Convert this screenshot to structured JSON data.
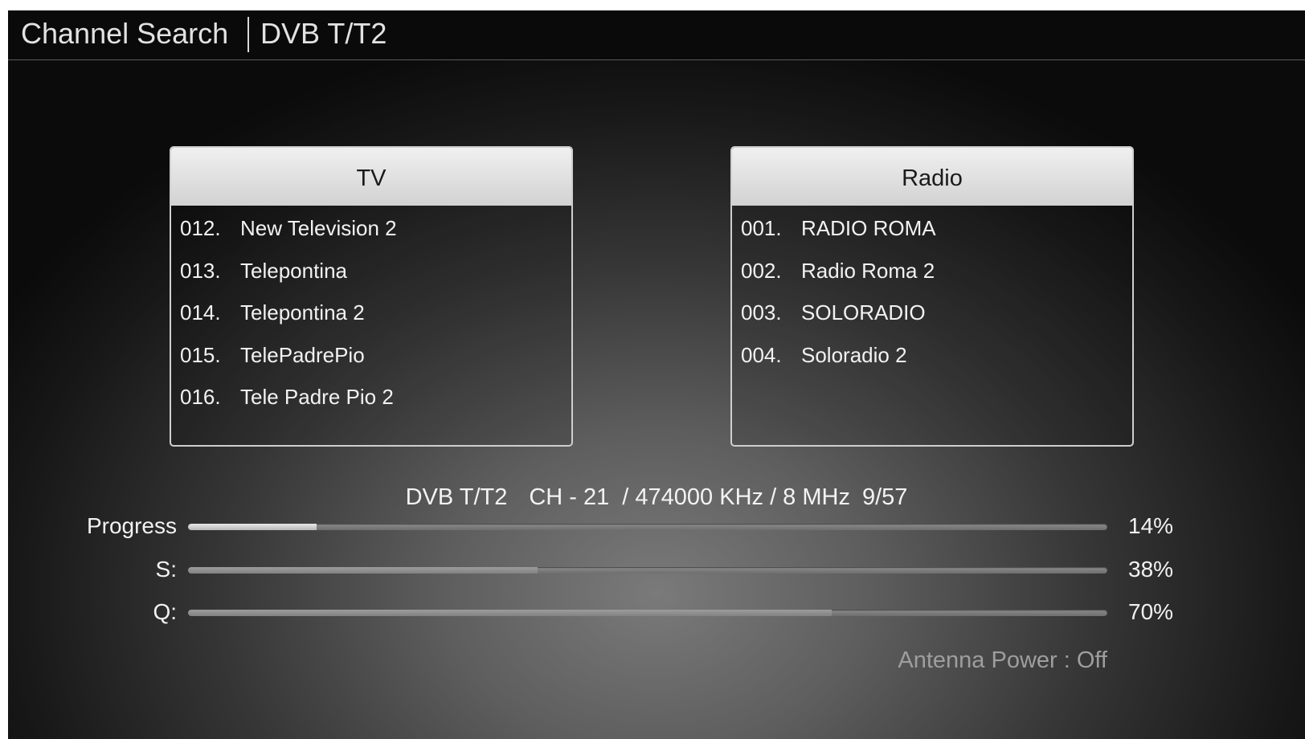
{
  "header": {
    "title": "Channel Search",
    "subtitle": "DVB T/T2"
  },
  "tv": {
    "heading": "TV",
    "channels": [
      {
        "num": "012.",
        "name": "New Television 2"
      },
      {
        "num": "013.",
        "name": "Telepontina"
      },
      {
        "num": "014.",
        "name": "Telepontina 2"
      },
      {
        "num": "015.",
        "name": "TelePadrePio"
      },
      {
        "num": "016.",
        "name": "Tele Padre Pio 2"
      }
    ]
  },
  "radio": {
    "heading": "Radio",
    "channels": [
      {
        "num": "001.",
        "name": "RADIO ROMA"
      },
      {
        "num": "002.",
        "name": "Radio Roma 2"
      },
      {
        "num": "003.",
        "name": "SOLORADIO"
      },
      {
        "num": "004.",
        "name": "Soloradio 2"
      }
    ]
  },
  "scan": {
    "system": "DVB T/T2",
    "channel": "CH - 21",
    "frequency": "/ 474000 KHz / 8 MHz",
    "count": "9/57"
  },
  "meters": {
    "progress": {
      "label": "Progress",
      "value": "14%",
      "fraction": 0.14
    },
    "signal": {
      "label": "S:",
      "value": "38%",
      "fraction": 0.38
    },
    "quality": {
      "label": "Q:",
      "value": "70%",
      "fraction": 0.7
    }
  },
  "antenna_power": "Antenna Power : Off",
  "colors": {
    "header_bg": "#0a0a0a",
    "panel_header_bg": "#e6e6e6",
    "text": "#f2f2f2",
    "muted_text": "#9e9e9e"
  }
}
